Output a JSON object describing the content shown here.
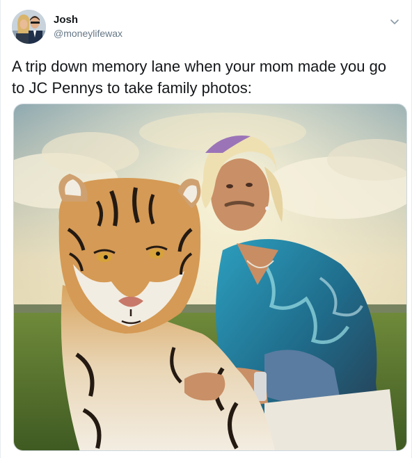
{
  "tweet": {
    "author": {
      "display_name": "Josh",
      "handle": "@moneylifewax",
      "avatar_icon": "profile-photo"
    },
    "text": "A trip down memory lane when your mom made you go to JC Pennys to take family photos:",
    "menu_icon": "chevron-down-icon"
  }
}
